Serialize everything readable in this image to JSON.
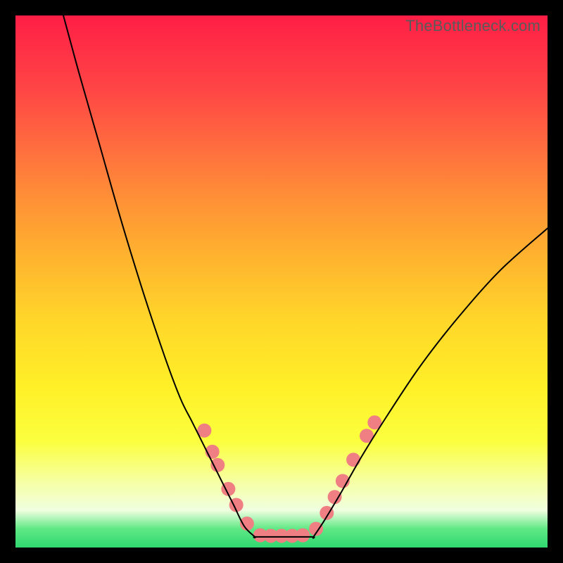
{
  "attribution": "TheBottleneck.com",
  "chart_data": {
    "type": "line",
    "title": "",
    "xlabel": "",
    "ylabel": "",
    "xlim": [
      0,
      100
    ],
    "ylim": [
      0,
      100
    ],
    "series": [
      {
        "name": "left-curve",
        "x": [
          9,
          12,
          16,
          20,
          24,
          28,
          31,
          33,
          35,
          37,
          39,
          41,
          43,
          45
        ],
        "y": [
          100,
          89,
          75,
          61,
          48,
          36,
          28,
          24,
          20,
          16,
          12,
          8,
          4,
          2
        ]
      },
      {
        "name": "floor",
        "x": [
          45,
          49,
          53,
          56
        ],
        "y": [
          2,
          2,
          2,
          2
        ]
      },
      {
        "name": "right-curve",
        "x": [
          56,
          58,
          61,
          65,
          70,
          76,
          83,
          91,
          100
        ],
        "y": [
          2,
          5,
          10,
          17,
          25,
          34,
          43,
          52,
          60
        ]
      }
    ],
    "markers": {
      "name": "dots",
      "points": [
        {
          "x": 35.5,
          "y": 22
        },
        {
          "x": 37.0,
          "y": 18
        },
        {
          "x": 38.0,
          "y": 15.5
        },
        {
          "x": 40.0,
          "y": 11
        },
        {
          "x": 41.5,
          "y": 8
        },
        {
          "x": 43.5,
          "y": 4.5
        },
        {
          "x": 46.0,
          "y": 2.3
        },
        {
          "x": 48.0,
          "y": 2.2
        },
        {
          "x": 50.0,
          "y": 2.2
        },
        {
          "x": 52.0,
          "y": 2.2
        },
        {
          "x": 54.0,
          "y": 2.3
        },
        {
          "x": 56.5,
          "y": 3.5
        },
        {
          "x": 58.5,
          "y": 6.5
        },
        {
          "x": 60.0,
          "y": 9.5
        },
        {
          "x": 61.5,
          "y": 12.5
        },
        {
          "x": 63.5,
          "y": 16.5
        },
        {
          "x": 66.0,
          "y": 21
        },
        {
          "x": 67.5,
          "y": 23.5
        }
      ],
      "color": "#ef7f82",
      "radius": 10
    },
    "curve_color": "#000000",
    "curve_width": 2
  }
}
